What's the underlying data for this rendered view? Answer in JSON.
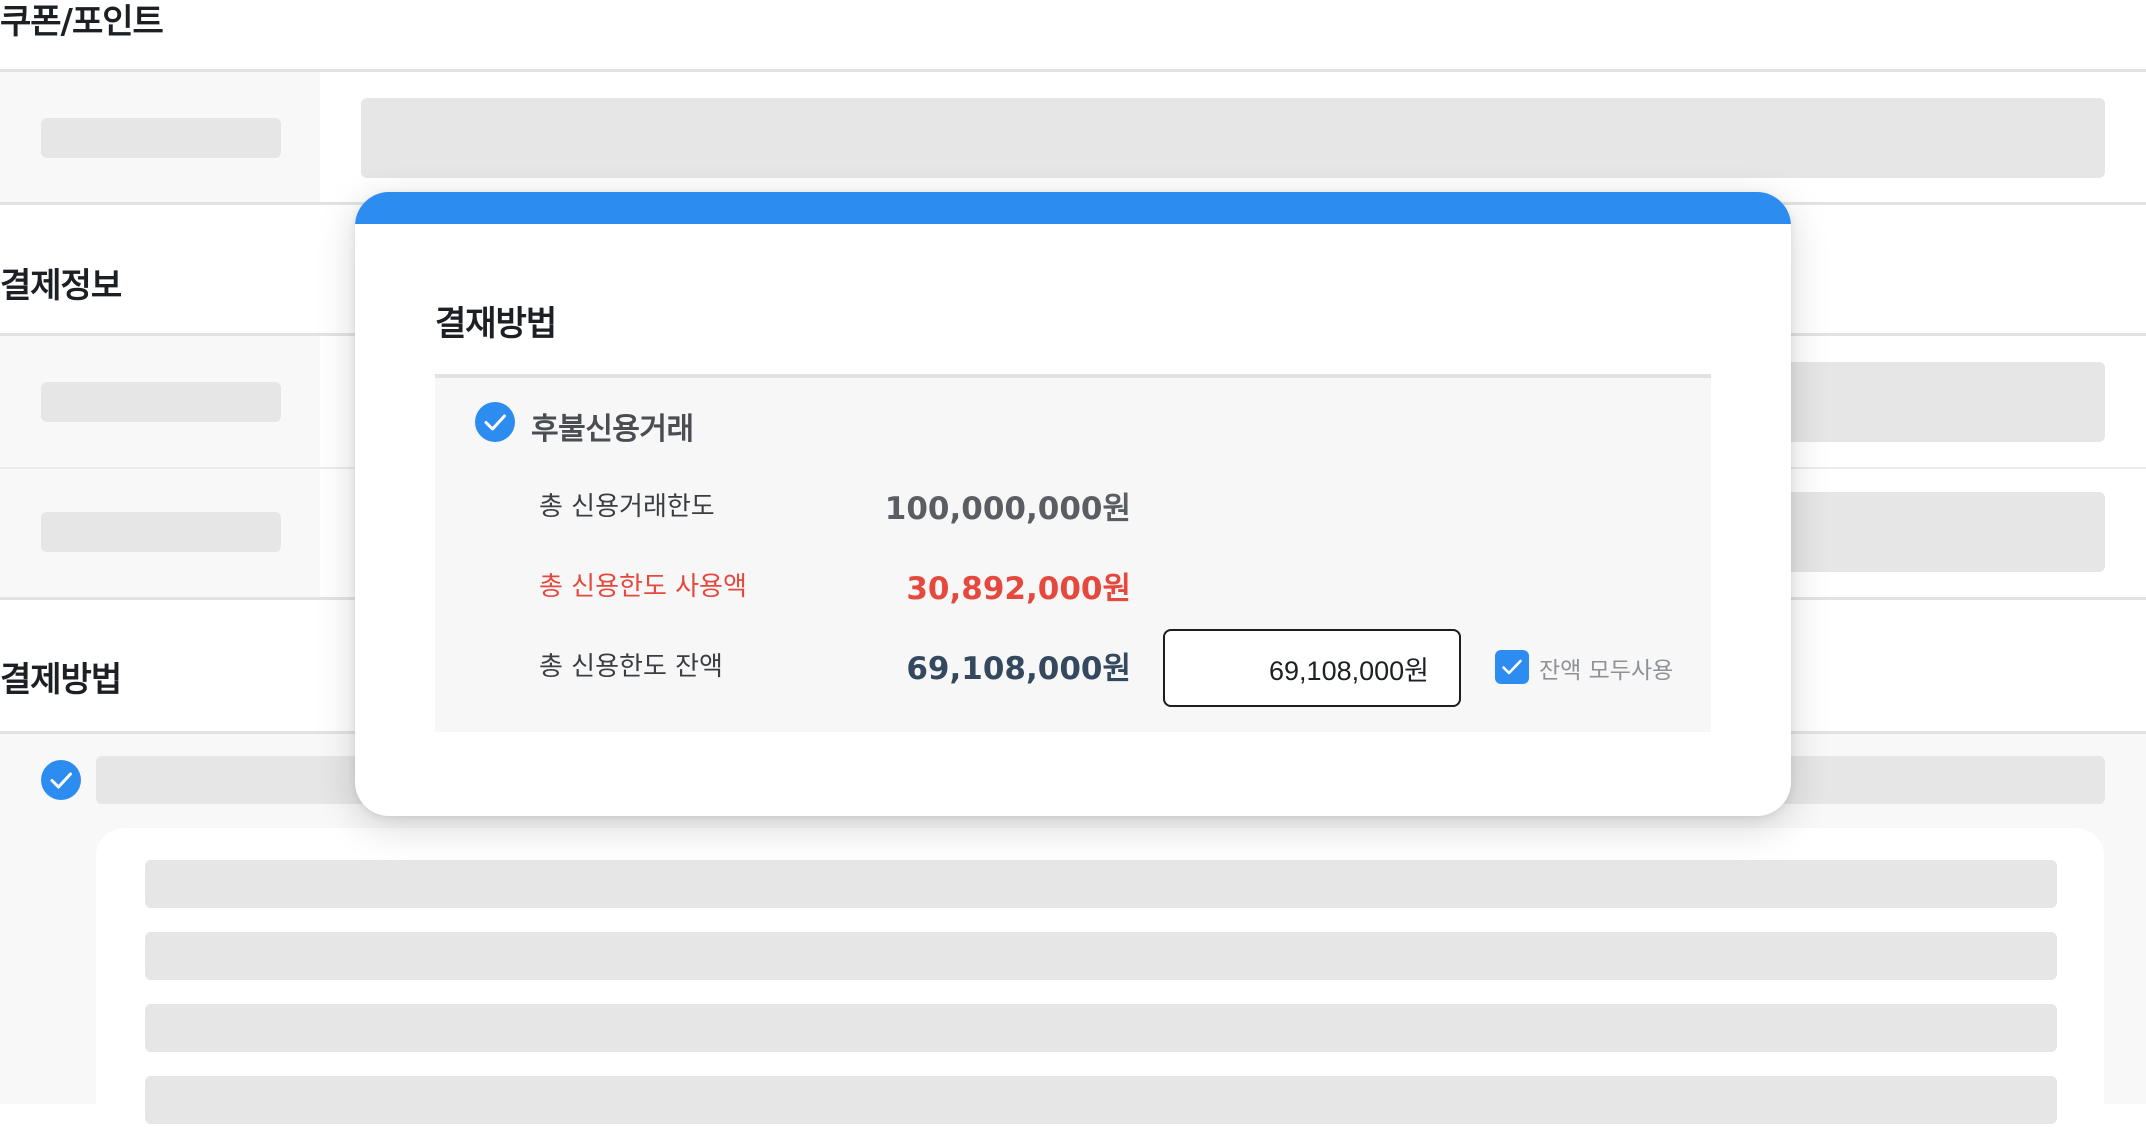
{
  "sections": {
    "coupon_point": {
      "title": "쿠폰/포인트"
    },
    "payment_info": {
      "title": "결제정보"
    },
    "payment_method": {
      "title": "결제방법"
    }
  },
  "modal": {
    "title": "결재방법",
    "option": {
      "label": "후불신용거래",
      "checked": true
    },
    "rows": [
      {
        "label": "총 신용거래한도",
        "value": "100,000,000원"
      },
      {
        "label": "총 신용한도 사용액",
        "value": "30,892,000원"
      },
      {
        "label": "총 신용한도 잔액",
        "value": "69,108,000원"
      }
    ],
    "amount_input": {
      "value": "69,108,000원"
    },
    "use_all_balance": {
      "label": "잔액 모두사용",
      "checked": true
    }
  },
  "colors": {
    "accent": "#2d8cf0",
    "warning": "#e5483d",
    "balance": "#34495e"
  },
  "icons": {
    "check": "check-icon"
  }
}
